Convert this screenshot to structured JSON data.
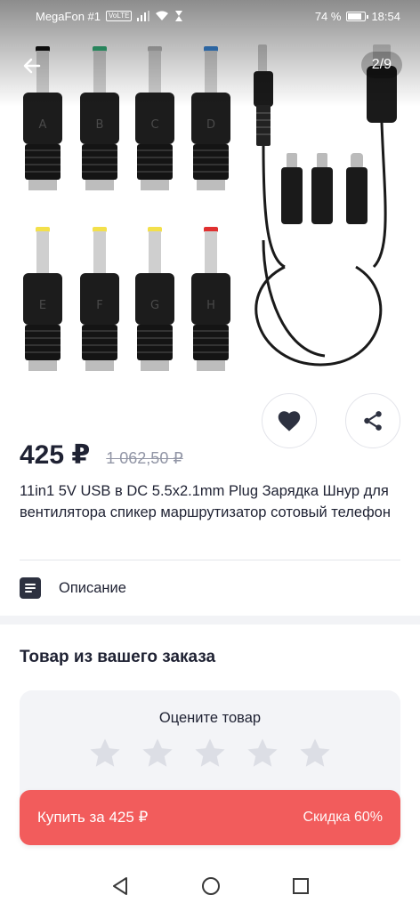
{
  "status_bar": {
    "carrier": "MegaFon #1",
    "network_badge": "VoLTE",
    "battery_percent": "74 %",
    "time": "18:54"
  },
  "gallery": {
    "counter": "2/9",
    "plug_letters": [
      "A",
      "B",
      "C",
      "D",
      "E",
      "F",
      "G",
      "H"
    ],
    "tip_colors": [
      "#111111",
      "#35b07a",
      "#b8b8b8",
      "#3a86d6",
      "#f3e04b",
      "#f3e04b",
      "#f3e04b",
      "#e03030"
    ]
  },
  "product": {
    "price": "425 ₽",
    "old_price": "1 062,50 ₽",
    "title": "11in1 5V USB в DC 5.5x2.1mm Plug Зарядка Шнур для вентилятора спикер маршрутизатор сотовый телефон"
  },
  "description": {
    "label": "Описание"
  },
  "order_section": {
    "title": "Товар из вашего заказа",
    "rate_label": "Оцените товар",
    "stars_total": 5,
    "stars_filled": 0
  },
  "buy": {
    "label": "Купить за 425 ₽",
    "discount": "Скидка 60%"
  },
  "colors": {
    "accent": "#f25c5c",
    "text": "#1f2233",
    "muted": "#9296a6"
  }
}
